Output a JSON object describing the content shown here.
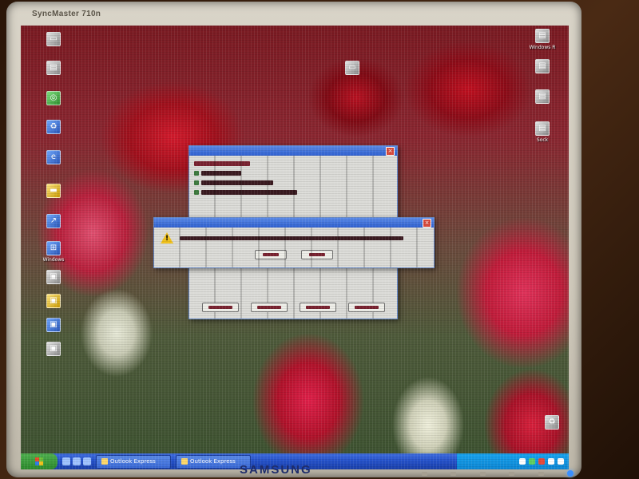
{
  "monitor": {
    "model_label": "SyncMaster 710n",
    "brand": "SAMSUNG"
  },
  "desktop": {
    "icons_left": [
      {
        "caption": "",
        "icon": "computer-icon"
      },
      {
        "caption": "",
        "icon": "documents-icon"
      },
      {
        "caption": "",
        "icon": "network-icon"
      },
      {
        "caption": "",
        "icon": "recycle-bin-icon"
      },
      {
        "caption": "",
        "icon": "internet-icon"
      },
      {
        "caption": "",
        "icon": "folder-icon"
      },
      {
        "caption": "",
        "icon": "shortcut-icon"
      },
      {
        "caption": "Windows",
        "icon": "windows-icon"
      },
      {
        "caption": "",
        "icon": "app-icon"
      },
      {
        "caption": "",
        "icon": "app-icon"
      },
      {
        "caption": "",
        "icon": "app-icon"
      },
      {
        "caption": "",
        "icon": "app-icon"
      }
    ],
    "icons_right": [
      {
        "caption": "Windows R",
        "icon": "shortcut-icon"
      },
      {
        "caption": "",
        "icon": "shortcut-icon"
      },
      {
        "caption": "",
        "icon": "shortcut-icon"
      },
      {
        "caption": "Sock",
        "icon": "shortcut-icon"
      }
    ]
  },
  "colors": {
    "taskbar": "#2350c8",
    "start": "#2b8a2b",
    "titlebar": "#2e5fd0",
    "warning": "#f2c21a"
  },
  "taskbar": {
    "items": [
      {
        "label": "Outlook Express",
        "icon": "outlook-icon"
      },
      {
        "label": "Outlook Express",
        "icon": "outlook-icon"
      }
    ]
  }
}
